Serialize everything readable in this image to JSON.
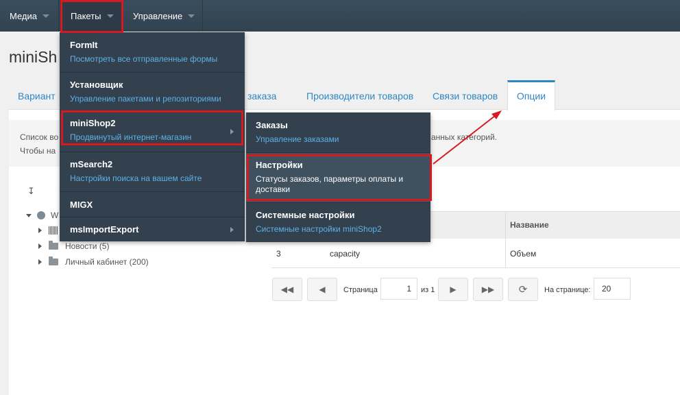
{
  "topbar": {
    "items": [
      {
        "label": "Медиа"
      },
      {
        "label": "Пакеты"
      },
      {
        "label": "Управление"
      }
    ]
  },
  "page": {
    "title": "miniSh",
    "tabs": [
      "Вариант",
      "сы заказа",
      "Производители товаров",
      "Связи товаров"
    ],
    "active_tab": "Опции",
    "info_line1_start": "Список во",
    "info_line1_end": "анных категорий.",
    "info_line2_start": "Чтобы на"
  },
  "tree": {
    "root_label": "W",
    "items": [
      {
        "label": "Новости (5)"
      },
      {
        "label": "Личный кабинет (200)"
      }
    ]
  },
  "grid": {
    "header_name": "Название",
    "row": {
      "id": "3",
      "key": "capacity",
      "name": "Объем"
    }
  },
  "pagination": {
    "page_label": "Страница",
    "page_value": "1",
    "of_label": "из 1",
    "per_page_label": "На странице:",
    "per_page_value": "20"
  },
  "menu_packages": [
    {
      "title": "FormIt",
      "sub": "Посмотреть все отправленные формы"
    },
    {
      "title": "Установщик",
      "sub": "Управление пакетами и репозиториями"
    },
    {
      "title": "miniShop2",
      "sub": "Продвинутый интернет-магазин"
    },
    {
      "title": "mSearch2",
      "sub": "Настройки поиска на вашем сайте"
    },
    {
      "title": "MIGX",
      "sub": ""
    },
    {
      "title": "msImportExport",
      "sub": ""
    }
  ],
  "menu_minishop": [
    {
      "title": "Заказы",
      "sub": "Управление заказами"
    },
    {
      "title": "Настройки",
      "sub": "Статусы заказов, параметры оплаты и доставки"
    },
    {
      "title": "Системные настройки",
      "sub": "Системные настройки miniShop2"
    }
  ],
  "colors": {
    "highlight_red": "#d71920",
    "link_blue": "#5fb1e6",
    "menu_bg": "#33414e"
  }
}
